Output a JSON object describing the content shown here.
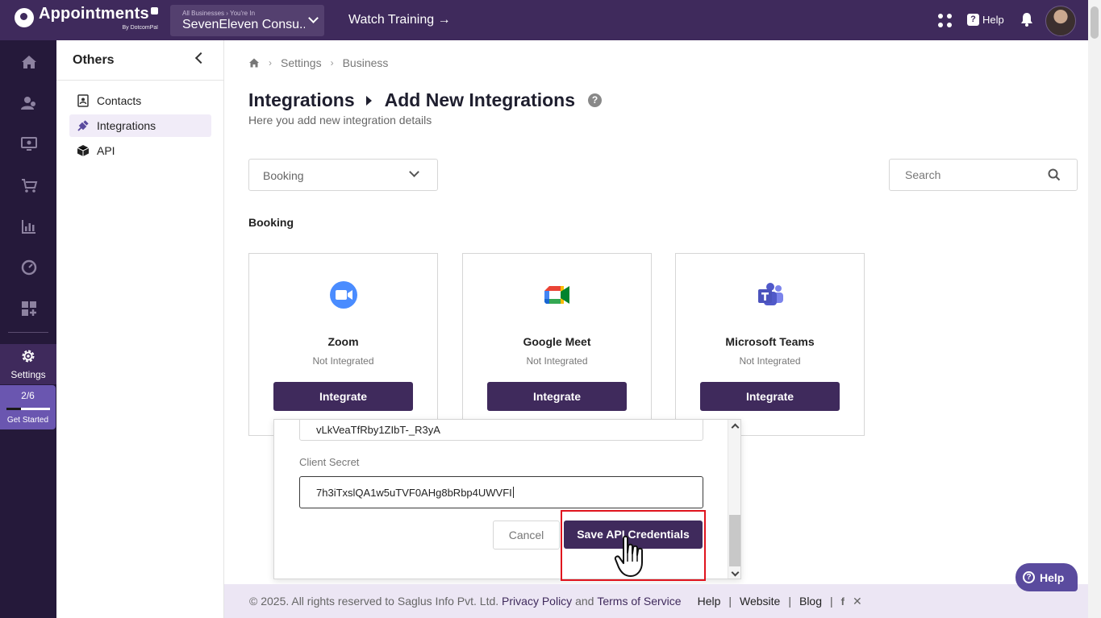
{
  "header": {
    "brand_title": "Appointments",
    "brand_sub": "By DotcomPal",
    "business_label": "All Businesses  ›  You're In",
    "business_name": "SevenEleven Consu...",
    "watch_training": "Watch Training →",
    "help_label": "Help",
    "icons": [
      "apps-grid-icon",
      "help-icon",
      "bell-icon",
      "avatar"
    ],
    "colors": {
      "topbar": "#3f2a5c",
      "accent": "#3f2a5c",
      "rail": "#25193a"
    }
  },
  "rail": {
    "icons": [
      "home-icon",
      "contacts-icon",
      "monitor-icon",
      "cart-icon",
      "reports-icon",
      "dashboard-icon",
      "apps-add-icon",
      "gear-icon"
    ],
    "settings_label": "Settings",
    "get_started": {
      "count": "2/6",
      "label": "Get Started",
      "progress": 0.33
    }
  },
  "sidebar": {
    "title": "Others",
    "items": [
      {
        "label": "Contacts",
        "icon": "contact-card-icon",
        "active": false
      },
      {
        "label": "Integrations",
        "icon": "plug-icon",
        "active": true
      },
      {
        "label": "API",
        "icon": "cube-icon",
        "active": false
      }
    ]
  },
  "breadcrumb": {
    "items": [
      "Settings",
      "Business"
    ]
  },
  "page": {
    "title": "Integrations",
    "title_sub": "Add New Integrations",
    "subtitle": "Here you add new integration details"
  },
  "filters": {
    "category_selected": "Booking",
    "search_placeholder": "Search"
  },
  "section_label": "Booking",
  "cards": [
    {
      "name": "Zoom",
      "status": "Not Integrated",
      "button": "Integrate",
      "icon": "zoom-icon"
    },
    {
      "name": "Google Meet",
      "status": "Not Integrated",
      "button": "Integrate",
      "icon": "google-meet-icon"
    },
    {
      "name": "Microsoft Teams",
      "status": "Not Integrated",
      "button": "Integrate",
      "icon": "teams-icon"
    }
  ],
  "modal": {
    "client_id_value": "vLkVeaTfRby1ZIbT-_R3yA",
    "client_secret_label": "Client Secret",
    "client_secret_value": "7h3iTxslQA1w5uTVF0AHg8bRbp4UWVFI",
    "cancel_label": "Cancel",
    "save_label": "Save API Credentials"
  },
  "footer": {
    "copyright": "©  2025. All rights reserved to Saglus Info Pvt. Ltd.",
    "privacy": "Privacy Policy",
    "and": "and",
    "terms": "Terms of Service",
    "links": [
      "Help",
      "Website",
      "Blog"
    ]
  },
  "help_fab": "Help"
}
